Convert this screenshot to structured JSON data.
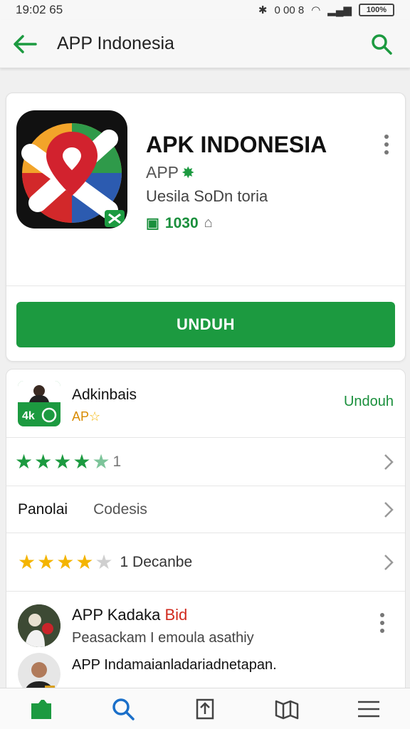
{
  "status_bar": {
    "time": "19:02 65",
    "right_text": "0 00 8",
    "battery": "100%"
  },
  "app_bar": {
    "title": "APP Indonesia"
  },
  "app_card": {
    "name": "APK INDONESIA",
    "developer": "APP",
    "description": "Uesila SoDn toria",
    "meta_count": "1030",
    "install_label": "UNDUH"
  },
  "related": {
    "name": "Adkinbais",
    "sub": "AP",
    "action": "Undouh"
  },
  "rating_row": {
    "stars": 4.5,
    "count": "1"
  },
  "info_row": {
    "label": "Panolai",
    "value": "Codesis"
  },
  "review_row": {
    "stars": 4,
    "text": "1 Decanbe"
  },
  "review": {
    "name": "APP Kadaka",
    "tag": "Bid",
    "text": "Peasackam I emoula asathiy",
    "second": "APP Indamaianladariadnetapan."
  },
  "bottom_nav": [
    "home-icon",
    "search-icon",
    "upload-icon",
    "library-icon",
    "menu-icon"
  ],
  "colors": {
    "accent": "#1c9a40",
    "star_orange": "#f4b400"
  }
}
